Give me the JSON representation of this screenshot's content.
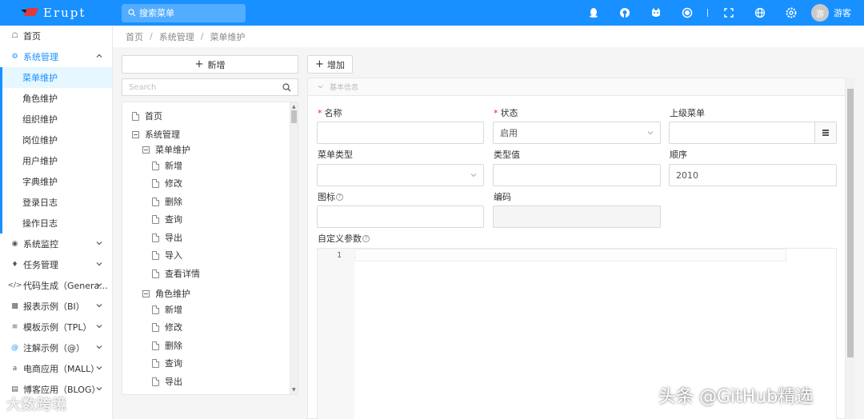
{
  "header": {
    "logo_text": "Erupt",
    "search_placeholder": "搜索菜单",
    "user_name": "游客",
    "avatar_text": "游",
    "icons": [
      "qq-icon",
      "github-icon",
      "gitee-icon",
      "record-icon",
      "fullscreen-icon",
      "language-icon",
      "settings-icon"
    ]
  },
  "sidebar": {
    "items": [
      {
        "label": "首页",
        "icon": "home-icon"
      },
      {
        "label": "系统管理",
        "icon": "settings-icon"
      },
      {
        "label": "系统监控",
        "icon": "monitor-icon"
      },
      {
        "label": "任务管理",
        "icon": "task-icon"
      },
      {
        "label": "代码生成（Genera...",
        "icon": "code-icon"
      },
      {
        "label": "报表示例（BI）",
        "icon": "chart-icon"
      },
      {
        "label": "模板示例（TPL）",
        "icon": "template-icon"
      },
      {
        "label": "注解示例（@）",
        "icon": "at-icon"
      },
      {
        "label": "电商应用（MALL）",
        "icon": "amazon-icon"
      },
      {
        "label": "博客应用（BLOG）",
        "icon": "blog-icon"
      }
    ],
    "sub_items": [
      "菜单维护",
      "角色维护",
      "组织维护",
      "岗位维护",
      "用户维护",
      "字典维护",
      "登录日志",
      "操作日志"
    ]
  },
  "breadcrumb": [
    "首页",
    "系统管理",
    "菜单维护"
  ],
  "tree": {
    "add_label": "新增",
    "search_placeholder": "Search",
    "nodes": [
      {
        "label": "首页",
        "type": "doc"
      },
      {
        "label": "系统管理",
        "type": "folder"
      },
      {
        "label": "菜单维护",
        "type": "folder"
      },
      {
        "label": "新增",
        "type": "doc"
      },
      {
        "label": "修改",
        "type": "doc"
      },
      {
        "label": "删除",
        "type": "doc"
      },
      {
        "label": "查询",
        "type": "doc"
      },
      {
        "label": "导出",
        "type": "doc"
      },
      {
        "label": "导入",
        "type": "doc"
      },
      {
        "label": "查看详情",
        "type": "doc"
      },
      {
        "label": "角色维护",
        "type": "folder"
      },
      {
        "label": "新增",
        "type": "doc"
      },
      {
        "label": "修改",
        "type": "doc"
      },
      {
        "label": "删除",
        "type": "doc"
      },
      {
        "label": "查询",
        "type": "doc"
      },
      {
        "label": "导出",
        "type": "doc"
      }
    ]
  },
  "form": {
    "add_label": "增加",
    "section_title": "基本信息",
    "fields": {
      "name": {
        "label": "名称",
        "value": ""
      },
      "status": {
        "label": "状态",
        "value": "启用"
      },
      "parent": {
        "label": "上级菜单",
        "value": ""
      },
      "type": {
        "label": "菜单类型",
        "value": ""
      },
      "type_value": {
        "label": "类型值",
        "value": ""
      },
      "sort": {
        "label": "顺序",
        "value": "2010"
      },
      "icon": {
        "label": "图标",
        "value": ""
      },
      "code": {
        "label": "编码",
        "value": ""
      },
      "params": {
        "label": "自定义参数"
      }
    },
    "help_mark": "?",
    "required_mark": "*",
    "editor_line_number": "1"
  },
  "watermarks": {
    "left": "大数跨境",
    "right": "头条 @GitHub精选"
  },
  "colors": {
    "primary": "#1890ff",
    "required": "#f5222d"
  }
}
